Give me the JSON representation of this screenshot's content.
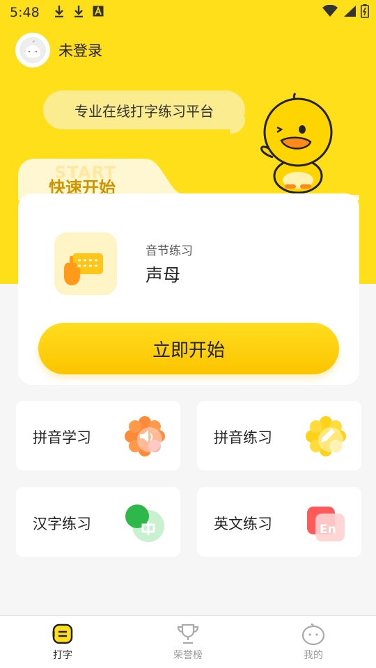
{
  "status_bar": {
    "time": "5:48",
    "icons": [
      "download-icon",
      "download-icon",
      "font-icon",
      "wifi-icon",
      "signal-icon",
      "battery-icon"
    ]
  },
  "user": {
    "login_text": "未登录"
  },
  "hero": {
    "slogan": "专业在线打字练习平台",
    "bg_color": "#ffdf1a"
  },
  "quick_start": {
    "watermark": "START",
    "title": "快速开始",
    "lesson_category": "音节练习",
    "lesson_name": "声母",
    "start_button": "立即开始"
  },
  "tiles": [
    {
      "label": "拼音学习",
      "icon": "speaker-flower-icon"
    },
    {
      "label": "拼音练习",
      "icon": "pencil-flower-icon"
    },
    {
      "label": "汉字练习",
      "icon": "chinese-char-icon"
    },
    {
      "label": "英文练习",
      "icon": "english-en-icon"
    }
  ],
  "tabbar": [
    {
      "label": "打字",
      "icon": "typing-icon",
      "active": true
    },
    {
      "label": "荣誉榜",
      "icon": "trophy-icon",
      "active": false
    },
    {
      "label": "我的",
      "icon": "profile-face-icon",
      "active": false
    }
  ]
}
